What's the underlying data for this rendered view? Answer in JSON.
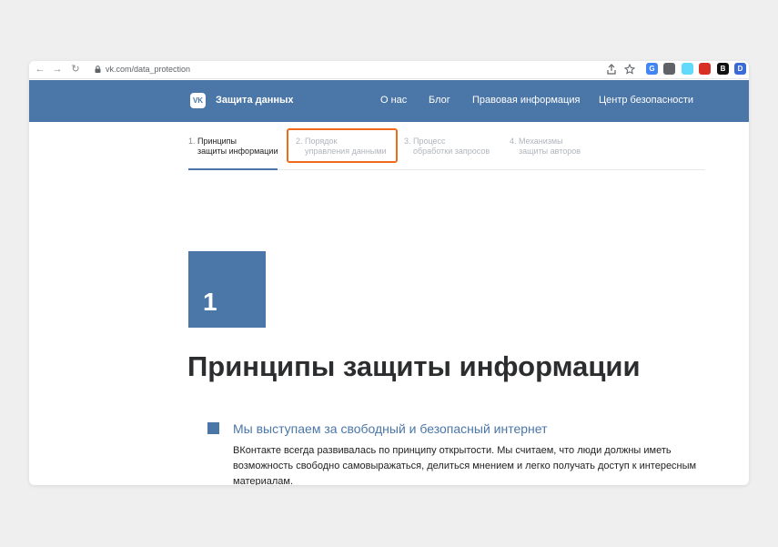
{
  "browser": {
    "url": "vk.com/data_protection",
    "extensions": [
      {
        "icon": "translate-extension-icon",
        "label": "G",
        "color": "#4285f4"
      },
      {
        "icon": "curl-extension-icon",
        "label": "",
        "color": "#5f6368"
      },
      {
        "icon": "react-extension-icon",
        "label": "",
        "color": "#61dafb"
      },
      {
        "icon": "pokeball-extension-icon",
        "label": "",
        "color": "#d93025"
      },
      {
        "icon": "b-extension-icon",
        "label": "B",
        "color": "#111111"
      },
      {
        "icon": "d-extension-icon",
        "label": "D",
        "color": "#3b6ad8"
      }
    ]
  },
  "header": {
    "brand": "Защита данных",
    "logo": "VK",
    "nav": [
      "О нас",
      "Блог",
      "Правовая информация",
      "Центр безопасности"
    ]
  },
  "steps": [
    {
      "num": "1.",
      "line1": "Принципы",
      "line2": "защиты информации",
      "active": true
    },
    {
      "num": "2.",
      "line1": "Порядок",
      "line2": "управления данными",
      "active": false
    },
    {
      "num": "3.",
      "line1": "Процесс",
      "line2": "обработки запросов",
      "active": false
    },
    {
      "num": "4.",
      "line1": "Механизмы",
      "line2": "защиты авторов",
      "active": false
    }
  ],
  "section": {
    "number": "1",
    "title": "Принципы защиты информации",
    "subheading": "Мы выступаем за свободный и безопасный интернет",
    "paragraph_lines": [
      "ВКонтакте всегда развивалась по принципу открытости. Мы считаем, что люди должны иметь",
      "возможность свободно самовыражаться, делиться мнением и легко получать доступ к интересным",
      "материалам."
    ]
  },
  "colors": {
    "brand_blue": "#4a76a8",
    "highlight_orange": "#ee6a1d"
  }
}
